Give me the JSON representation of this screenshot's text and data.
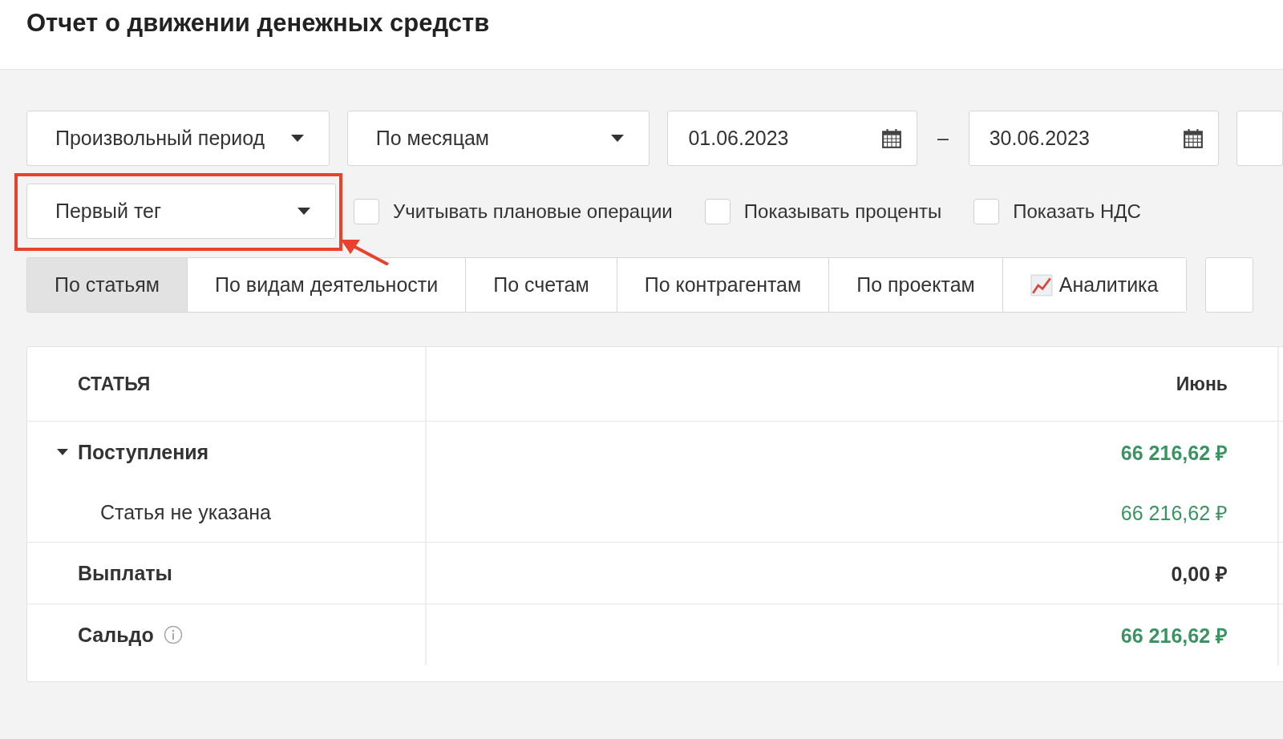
{
  "title": "Отчет о движении денежных средств",
  "filters": {
    "period": "Произвольный период",
    "grouping": "По месяцам",
    "date_from": "01.06.2023",
    "date_separator": "–",
    "date_to": "30.06.2023",
    "tag": {
      "value": "Первый тег",
      "highlighted": true
    }
  },
  "checkboxes": [
    {
      "label": "Учитывать плановые операции",
      "checked": false
    },
    {
      "label": "Показывать проценты",
      "checked": false
    },
    {
      "label": "Показать НДС",
      "checked": false
    }
  ],
  "tabs": [
    {
      "label": "По статьям",
      "selected": true
    },
    {
      "label": "По видам деятельности",
      "selected": false
    },
    {
      "label": "По счетам",
      "selected": false
    },
    {
      "label": "По контрагентам",
      "selected": false
    },
    {
      "label": "По проектам",
      "selected": false
    },
    {
      "label": "Аналитика",
      "selected": false,
      "kind": "chart"
    }
  ],
  "table": {
    "columns": [
      "СТАТЬЯ",
      "Июнь"
    ],
    "rows": [
      {
        "kind": "group",
        "label": "Поступления",
        "expanded": true,
        "amount": "66 216,62 ₽",
        "color": "#3a9462"
      },
      {
        "kind": "child",
        "label": "Статья не указана",
        "amount": "66 216,62 ₽",
        "color": "#3a9462"
      },
      {
        "kind": "group",
        "label": "Выплаты",
        "amount": "0,00 ₽",
        "color": "#333333"
      },
      {
        "kind": "total",
        "label": "Сальдо",
        "info": true,
        "amount": "66 216,62 ₽",
        "color": "#3a9462"
      }
    ]
  }
}
